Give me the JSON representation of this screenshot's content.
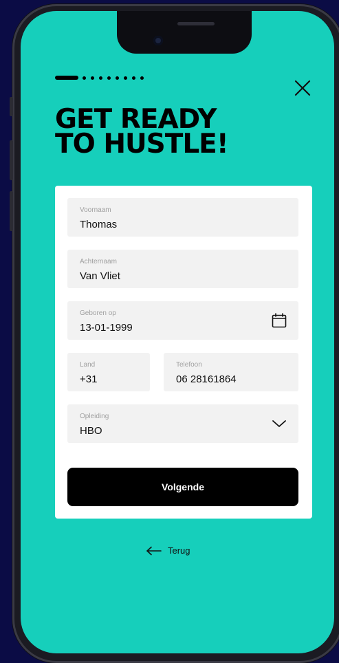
{
  "header": {
    "progress": {
      "current_step": 1,
      "total_steps": 9
    },
    "title_line1": "GET READY",
    "title_line2": "TO HUSTLE!"
  },
  "form": {
    "first_name": {
      "label": "Voornaam",
      "value": "Thomas"
    },
    "last_name": {
      "label": "Achternaam",
      "value": "Van Vliet"
    },
    "birth_date": {
      "label": "Geboren op",
      "value": "13-01-1999",
      "icon": "calendar-icon"
    },
    "country_code": {
      "label": "Land",
      "value": "+31"
    },
    "phone": {
      "label": "Telefoon",
      "value": "06 28161864"
    },
    "education": {
      "label": "Opleiding",
      "value": "HBO",
      "icon": "chevron-down-icon"
    },
    "submit_label": "Volgende"
  },
  "footer": {
    "back_label": "Terug",
    "back_icon": "arrow-left-icon"
  },
  "colors": {
    "screen_bg": "#16cfbb",
    "page_bg": "#0b0c45",
    "button_bg": "#000000",
    "field_bg": "#f2f2f2"
  }
}
